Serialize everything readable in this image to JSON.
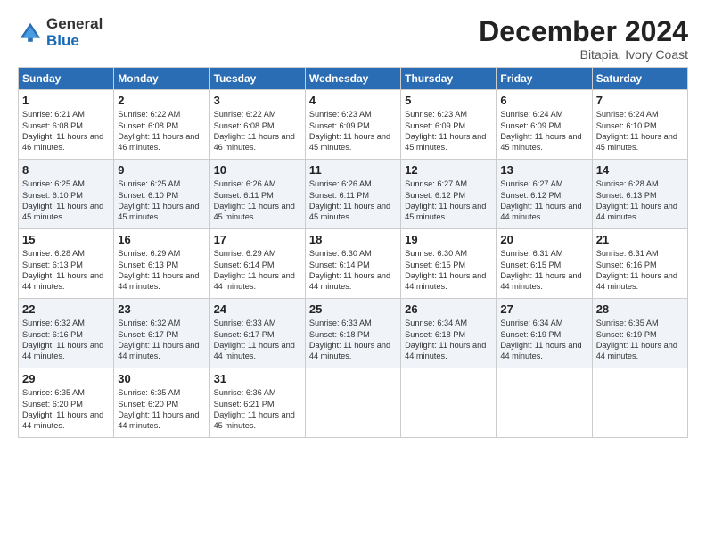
{
  "logo": {
    "general": "General",
    "blue": "Blue"
  },
  "title": "December 2024",
  "location": "Bitapia, Ivory Coast",
  "days_header": [
    "Sunday",
    "Monday",
    "Tuesday",
    "Wednesday",
    "Thursday",
    "Friday",
    "Saturday"
  ],
  "weeks": [
    [
      {
        "day": "1",
        "rise": "Sunrise: 6:21 AM",
        "set": "Sunset: 6:08 PM",
        "daylight": "Daylight: 11 hours and 46 minutes."
      },
      {
        "day": "2",
        "rise": "Sunrise: 6:22 AM",
        "set": "Sunset: 6:08 PM",
        "daylight": "Daylight: 11 hours and 46 minutes."
      },
      {
        "day": "3",
        "rise": "Sunrise: 6:22 AM",
        "set": "Sunset: 6:08 PM",
        "daylight": "Daylight: 11 hours and 46 minutes."
      },
      {
        "day": "4",
        "rise": "Sunrise: 6:23 AM",
        "set": "Sunset: 6:09 PM",
        "daylight": "Daylight: 11 hours and 45 minutes."
      },
      {
        "day": "5",
        "rise": "Sunrise: 6:23 AM",
        "set": "Sunset: 6:09 PM",
        "daylight": "Daylight: 11 hours and 45 minutes."
      },
      {
        "day": "6",
        "rise": "Sunrise: 6:24 AM",
        "set": "Sunset: 6:09 PM",
        "daylight": "Daylight: 11 hours and 45 minutes."
      },
      {
        "day": "7",
        "rise": "Sunrise: 6:24 AM",
        "set": "Sunset: 6:10 PM",
        "daylight": "Daylight: 11 hours and 45 minutes."
      }
    ],
    [
      {
        "day": "8",
        "rise": "Sunrise: 6:25 AM",
        "set": "Sunset: 6:10 PM",
        "daylight": "Daylight: 11 hours and 45 minutes."
      },
      {
        "day": "9",
        "rise": "Sunrise: 6:25 AM",
        "set": "Sunset: 6:10 PM",
        "daylight": "Daylight: 11 hours and 45 minutes."
      },
      {
        "day": "10",
        "rise": "Sunrise: 6:26 AM",
        "set": "Sunset: 6:11 PM",
        "daylight": "Daylight: 11 hours and 45 minutes."
      },
      {
        "day": "11",
        "rise": "Sunrise: 6:26 AM",
        "set": "Sunset: 6:11 PM",
        "daylight": "Daylight: 11 hours and 45 minutes."
      },
      {
        "day": "12",
        "rise": "Sunrise: 6:27 AM",
        "set": "Sunset: 6:12 PM",
        "daylight": "Daylight: 11 hours and 45 minutes."
      },
      {
        "day": "13",
        "rise": "Sunrise: 6:27 AM",
        "set": "Sunset: 6:12 PM",
        "daylight": "Daylight: 11 hours and 44 minutes."
      },
      {
        "day": "14",
        "rise": "Sunrise: 6:28 AM",
        "set": "Sunset: 6:13 PM",
        "daylight": "Daylight: 11 hours and 44 minutes."
      }
    ],
    [
      {
        "day": "15",
        "rise": "Sunrise: 6:28 AM",
        "set": "Sunset: 6:13 PM",
        "daylight": "Daylight: 11 hours and 44 minutes."
      },
      {
        "day": "16",
        "rise": "Sunrise: 6:29 AM",
        "set": "Sunset: 6:13 PM",
        "daylight": "Daylight: 11 hours and 44 minutes."
      },
      {
        "day": "17",
        "rise": "Sunrise: 6:29 AM",
        "set": "Sunset: 6:14 PM",
        "daylight": "Daylight: 11 hours and 44 minutes."
      },
      {
        "day": "18",
        "rise": "Sunrise: 6:30 AM",
        "set": "Sunset: 6:14 PM",
        "daylight": "Daylight: 11 hours and 44 minutes."
      },
      {
        "day": "19",
        "rise": "Sunrise: 6:30 AM",
        "set": "Sunset: 6:15 PM",
        "daylight": "Daylight: 11 hours and 44 minutes."
      },
      {
        "day": "20",
        "rise": "Sunrise: 6:31 AM",
        "set": "Sunset: 6:15 PM",
        "daylight": "Daylight: 11 hours and 44 minutes."
      },
      {
        "day": "21",
        "rise": "Sunrise: 6:31 AM",
        "set": "Sunset: 6:16 PM",
        "daylight": "Daylight: 11 hours and 44 minutes."
      }
    ],
    [
      {
        "day": "22",
        "rise": "Sunrise: 6:32 AM",
        "set": "Sunset: 6:16 PM",
        "daylight": "Daylight: 11 hours and 44 minutes."
      },
      {
        "day": "23",
        "rise": "Sunrise: 6:32 AM",
        "set": "Sunset: 6:17 PM",
        "daylight": "Daylight: 11 hours and 44 minutes."
      },
      {
        "day": "24",
        "rise": "Sunrise: 6:33 AM",
        "set": "Sunset: 6:17 PM",
        "daylight": "Daylight: 11 hours and 44 minutes."
      },
      {
        "day": "25",
        "rise": "Sunrise: 6:33 AM",
        "set": "Sunset: 6:18 PM",
        "daylight": "Daylight: 11 hours and 44 minutes."
      },
      {
        "day": "26",
        "rise": "Sunrise: 6:34 AM",
        "set": "Sunset: 6:18 PM",
        "daylight": "Daylight: 11 hours and 44 minutes."
      },
      {
        "day": "27",
        "rise": "Sunrise: 6:34 AM",
        "set": "Sunset: 6:19 PM",
        "daylight": "Daylight: 11 hours and 44 minutes."
      },
      {
        "day": "28",
        "rise": "Sunrise: 6:35 AM",
        "set": "Sunset: 6:19 PM",
        "daylight": "Daylight: 11 hours and 44 minutes."
      }
    ],
    [
      {
        "day": "29",
        "rise": "Sunrise: 6:35 AM",
        "set": "Sunset: 6:20 PM",
        "daylight": "Daylight: 11 hours and 44 minutes."
      },
      {
        "day": "30",
        "rise": "Sunrise: 6:35 AM",
        "set": "Sunset: 6:20 PM",
        "daylight": "Daylight: 11 hours and 44 minutes."
      },
      {
        "day": "31",
        "rise": "Sunrise: 6:36 AM",
        "set": "Sunset: 6:21 PM",
        "daylight": "Daylight: 11 hours and 45 minutes."
      },
      null,
      null,
      null,
      null
    ]
  ]
}
